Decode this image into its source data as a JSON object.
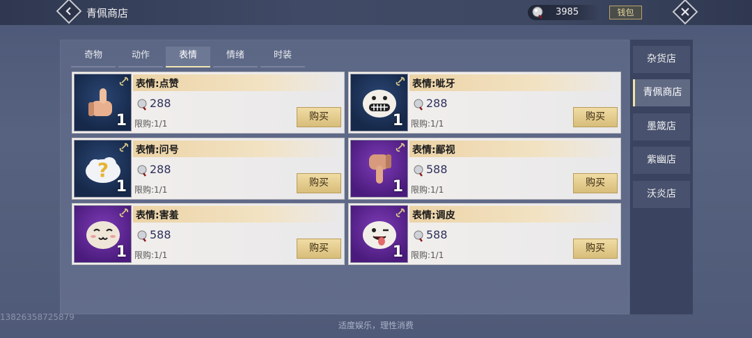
{
  "header": {
    "title": "青佩商店",
    "currency_value": "3985",
    "wallet_label": "钱包"
  },
  "tabs": [
    {
      "label": "奇物"
    },
    {
      "label": "动作"
    },
    {
      "label": "表情"
    },
    {
      "label": "情绪"
    },
    {
      "label": "时装"
    }
  ],
  "items": [
    {
      "name": "表情:点赞",
      "price": "288",
      "limit": "限购:1/1",
      "qty": "1",
      "buy": "购买",
      "bg": "blue",
      "emote": "thumbs-up"
    },
    {
      "name": "表情:呲牙",
      "price": "288",
      "limit": "限购:1/1",
      "qty": "1",
      "buy": "购买",
      "bg": "blue",
      "emote": "grin"
    },
    {
      "name": "表情:问号",
      "price": "288",
      "limit": "限购:1/1",
      "qty": "1",
      "buy": "购买",
      "bg": "blue",
      "emote": "question"
    },
    {
      "name": "表情:鄙视",
      "price": "588",
      "limit": "限购:1/1",
      "qty": "1",
      "buy": "购买",
      "bg": "purple",
      "emote": "thumbs-down"
    },
    {
      "name": "表情:害羞",
      "price": "588",
      "limit": "限购:1/1",
      "qty": "1",
      "buy": "购买",
      "bg": "purple",
      "emote": "shy"
    },
    {
      "name": "表情:调皮",
      "price": "588",
      "limit": "限购:1/1",
      "qty": "1",
      "buy": "购买",
      "bg": "purple",
      "emote": "tongue"
    }
  ],
  "side_nav": [
    {
      "label": "杂货店"
    },
    {
      "label": "青佩商店"
    },
    {
      "label": "墨箴店"
    },
    {
      "label": "紫幽店"
    },
    {
      "label": "沃炎店"
    }
  ],
  "footer": "适度娱乐，理性消费",
  "watermark": "13826358725879"
}
